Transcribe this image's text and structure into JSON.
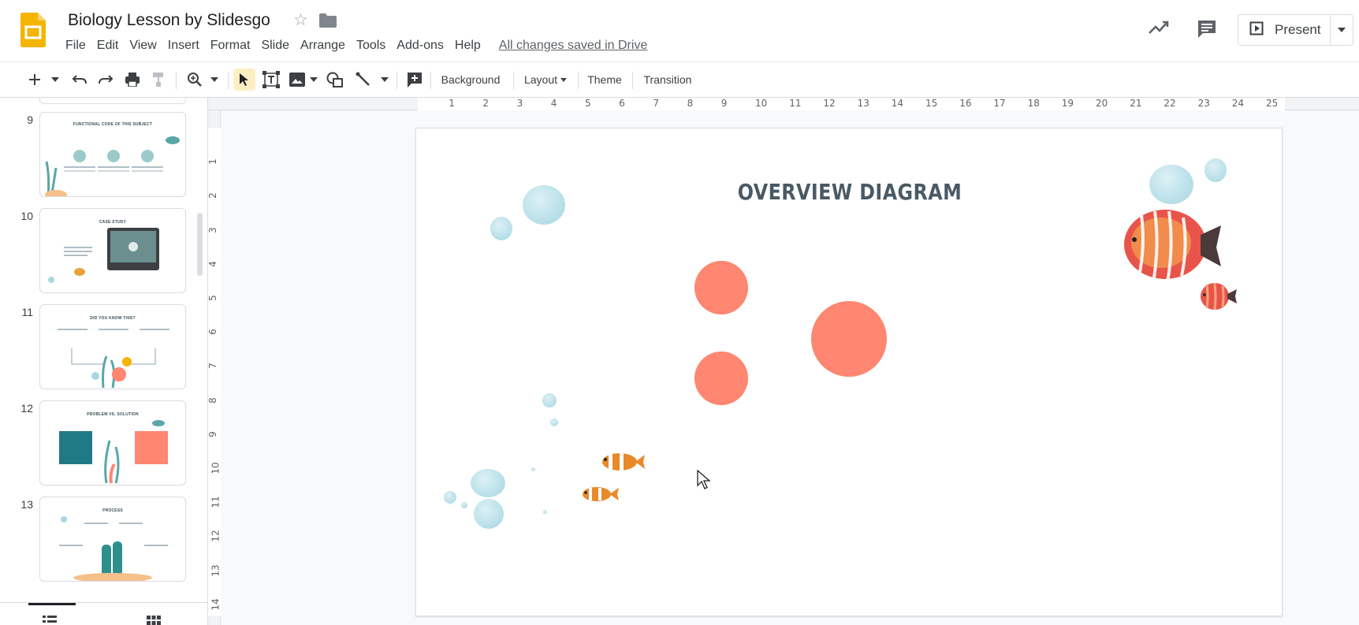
{
  "app": {
    "doc_title": "Biology Lesson by Slidesgo",
    "save_status": "All changes saved in Drive",
    "present_label": "Present"
  },
  "menu": [
    "File",
    "Edit",
    "View",
    "Insert",
    "Format",
    "Slide",
    "Arrange",
    "Tools",
    "Add-ons",
    "Help"
  ],
  "toolbar": {
    "background_label": "Background",
    "layout_label": "Layout",
    "theme_label": "Theme",
    "transition_label": "Transition"
  },
  "filmstrip": {
    "slides": [
      {
        "num": "9",
        "title": "FUNCTIONAL CODE OF THIS SUBJECT"
      },
      {
        "num": "10",
        "title": "CASE STUDY"
      },
      {
        "num": "11",
        "title": "DID YOU KNOW THIS?"
      },
      {
        "num": "12",
        "title": "PROBLEM VS. SOLUTION"
      },
      {
        "num": "13",
        "title": "PROCESS"
      }
    ]
  },
  "rulers": {
    "horizontal": [
      "1",
      "2",
      "3",
      "4",
      "5",
      "6",
      "7",
      "8",
      "9",
      "10",
      "11",
      "12",
      "13",
      "14",
      "15",
      "16",
      "17",
      "18",
      "19",
      "20",
      "21",
      "22",
      "23",
      "24",
      "25"
    ],
    "vertical": [
      "1",
      "2",
      "3",
      "4",
      "5",
      "6",
      "7",
      "8",
      "9",
      "10",
      "11",
      "12",
      "13",
      "14"
    ]
  },
  "slide": {
    "title": "OVERVIEW DIAGRAM",
    "circle_color": "#ff8670"
  },
  "colors": {
    "accent_yellow": "#f4b400",
    "select_highlight": "#feefc3",
    "title_text": "#4a5a64"
  }
}
